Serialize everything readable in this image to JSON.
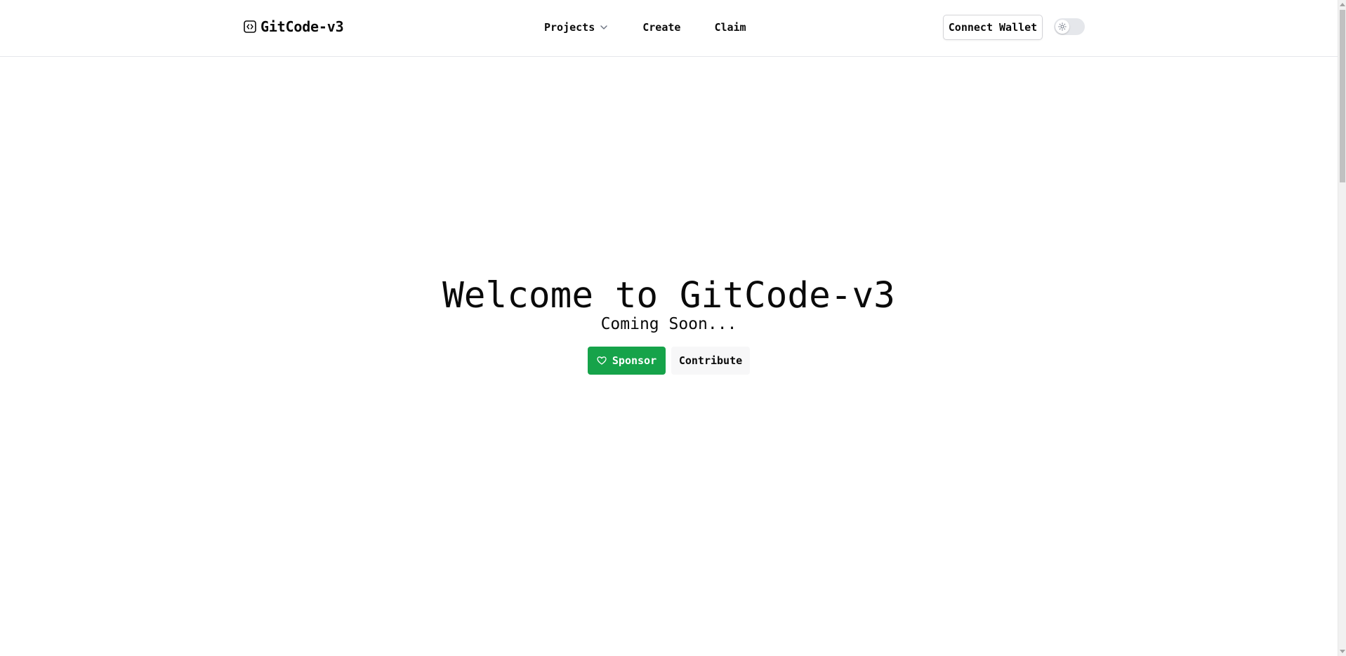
{
  "header": {
    "logo_text": "GitCode-v3",
    "nav": {
      "projects_label": "Projects",
      "create_label": "Create",
      "claim_label": "Claim"
    },
    "connect_wallet_label": "Connect Wallet",
    "theme_toggle": {
      "state": "light",
      "icon": "sun-icon"
    }
  },
  "hero": {
    "title": "Welcome to GitCode-v3",
    "subtitle": "Coming Soon...",
    "sponsor_label": "Sponsor",
    "contribute_label": "Contribute"
  },
  "colors": {
    "accent": "#16a34a",
    "border": "#e5e7eb",
    "text": "#0a0a0a"
  }
}
